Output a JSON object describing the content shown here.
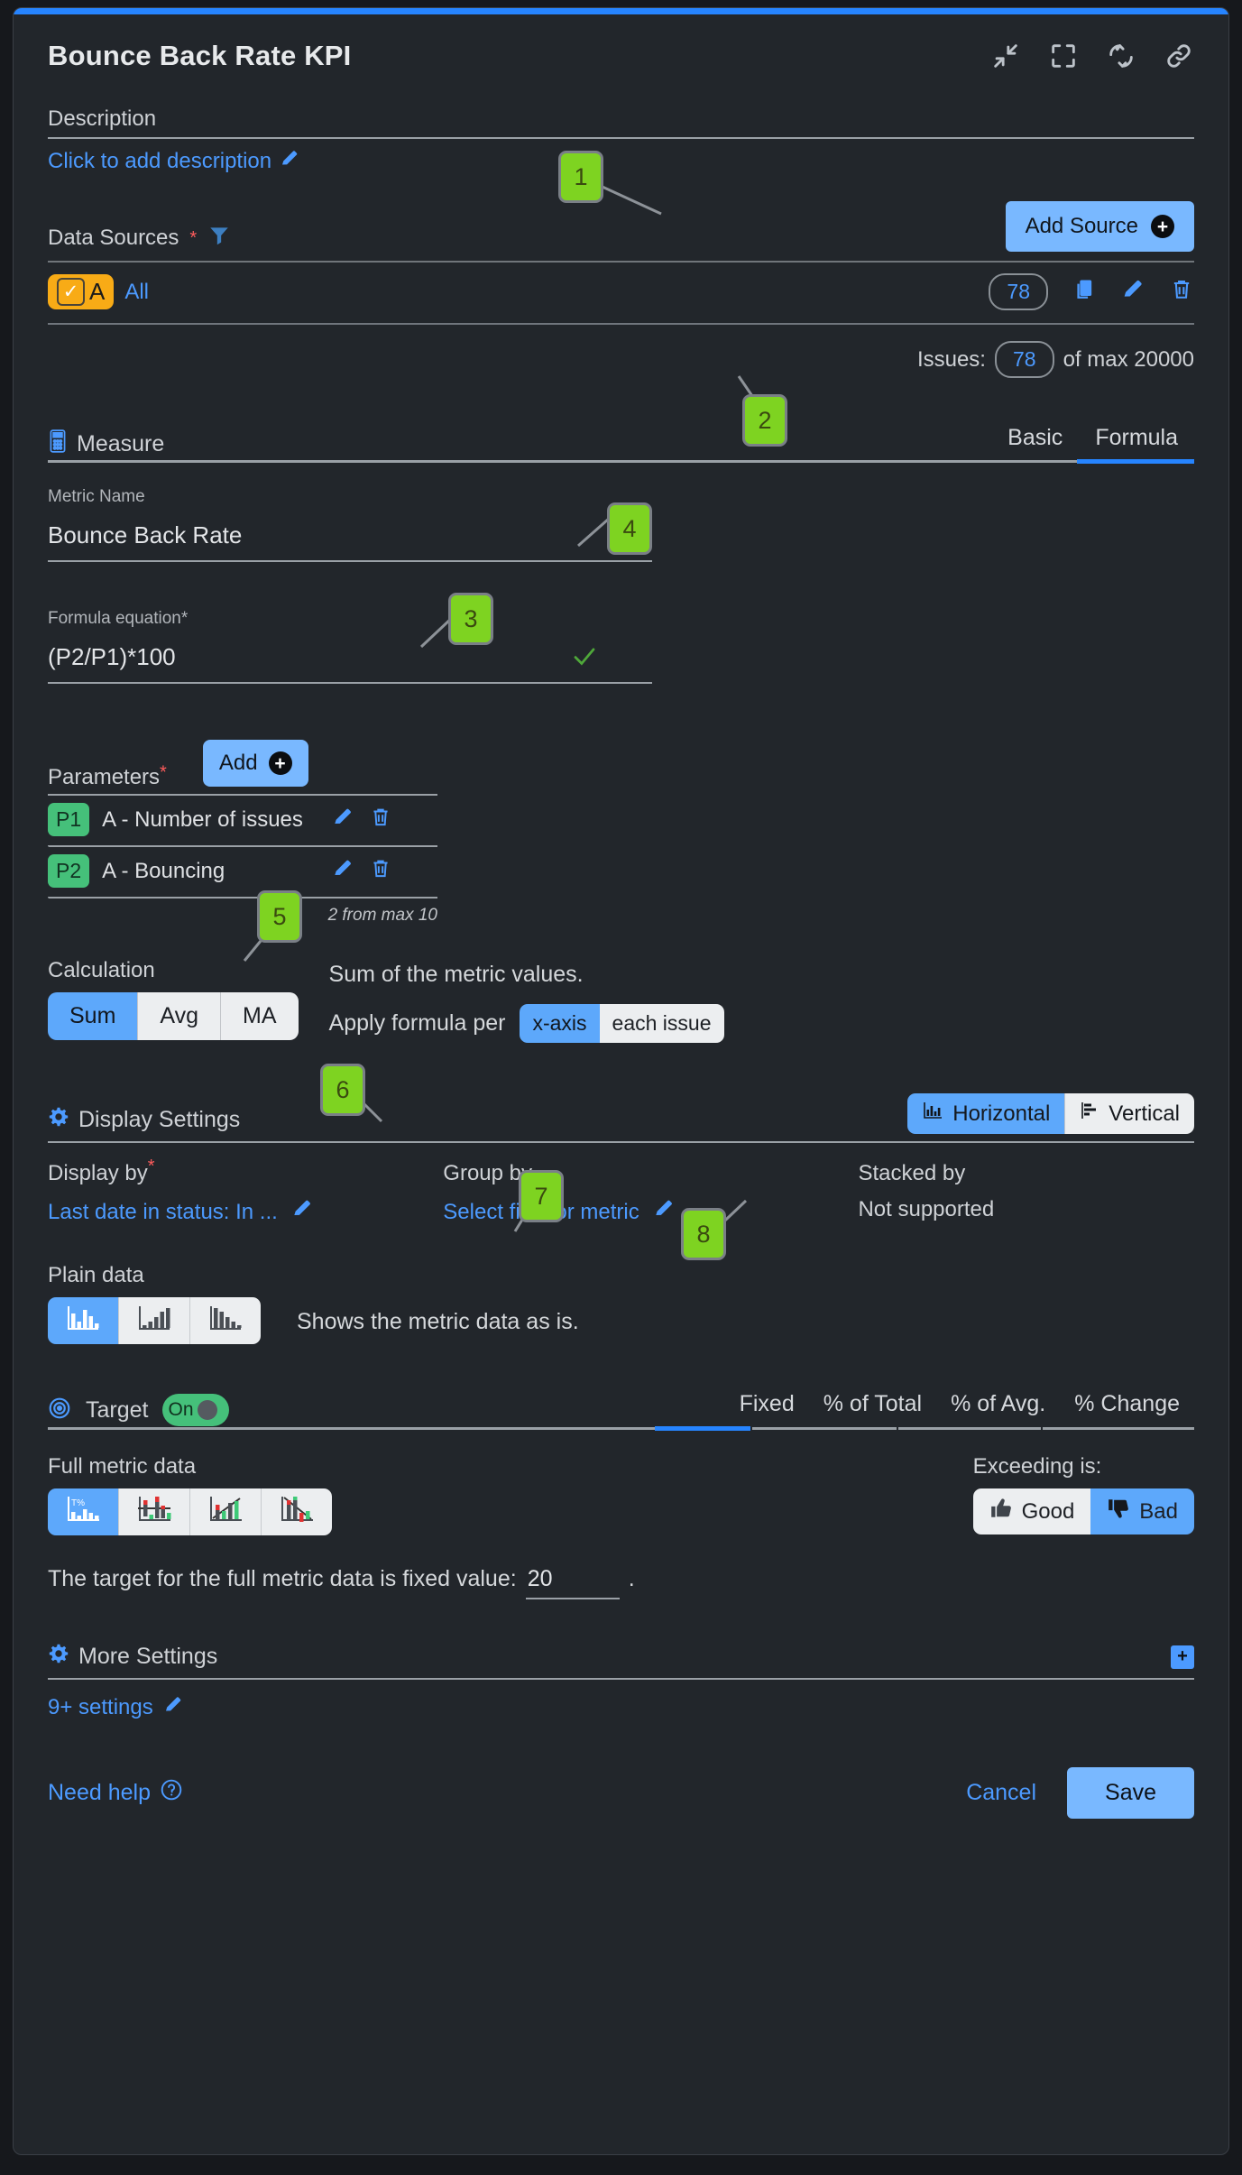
{
  "header": {
    "title": "Bounce Back Rate KPI",
    "icons": [
      "collapse-icon",
      "fullscreen-icon",
      "refresh-icon",
      "link-icon"
    ]
  },
  "description": {
    "label": "Description",
    "placeholder": "Click to add description",
    "edit_icon": "pencil-icon"
  },
  "data_sources": {
    "label": "Data Sources",
    "required": "*",
    "filter_icon": "filter-icon",
    "add_button": "Add Source",
    "rows": [
      {
        "letter": "A",
        "name": "All",
        "count": "78",
        "checked": true,
        "actions": [
          "copy-icon",
          "pencil-icon",
          "trash-icon"
        ]
      }
    ],
    "issues_prefix": "Issues:",
    "issues_count": "78",
    "issues_suffix": "of max 20000"
  },
  "measure": {
    "title": "Measure",
    "icon": "calculator-icon",
    "tabs": [
      {
        "label": "Basic",
        "active": false
      },
      {
        "label": "Formula",
        "active": true
      }
    ],
    "metric_name_label": "Metric Name",
    "metric_name_value": "Bounce Back Rate",
    "formula_label": "Formula equation*",
    "formula_value": "(P2/P1)*100",
    "formula_valid_icon": "check-icon"
  },
  "parameters": {
    "label": "Parameters",
    "required": "*",
    "add_button": "Add",
    "items": [
      {
        "badge": "P1",
        "name": "A - Number of issues",
        "actions": [
          "pencil-icon",
          "trash-icon"
        ]
      },
      {
        "badge": "P2",
        "name": "A - Bouncing",
        "actions": [
          "pencil-icon",
          "trash-icon"
        ]
      }
    ],
    "note": "2 from max 10"
  },
  "calculation": {
    "label": "Calculation",
    "options": [
      {
        "label": "Sum",
        "active": true
      },
      {
        "label": "Avg",
        "active": false
      },
      {
        "label": "MA",
        "active": false
      }
    ],
    "description": "Sum of the metric values.",
    "apply_label": "Apply formula per",
    "apply_options": [
      {
        "label": "x-axis",
        "active": true
      },
      {
        "label": "each issue",
        "active": false
      }
    ]
  },
  "display_settings": {
    "title": "Display Settings",
    "icon": "gear-icon",
    "orientation": [
      {
        "label": "Horizontal",
        "active": true,
        "icon": "bar-chart-horizontal-icon"
      },
      {
        "label": "Vertical",
        "active": false,
        "icon": "bar-chart-vertical-icon"
      }
    ],
    "columns": [
      {
        "label": "Display by",
        "required": "*",
        "value": "Last date in status: In ...",
        "link": true,
        "edit_icon": "pencil-icon"
      },
      {
        "label": "Group by",
        "required": "",
        "value": "Select field or metric",
        "link": true,
        "edit_icon": "pencil-icon"
      },
      {
        "label": "Stacked by",
        "required": "",
        "value": "Not supported",
        "link": false,
        "edit_icon": ""
      }
    ]
  },
  "plain_data": {
    "label": "Plain data",
    "options": [
      {
        "icon": "plain-bars-icon",
        "active": true
      },
      {
        "icon": "cumulative-bars-icon",
        "active": false
      },
      {
        "icon": "descending-bars-icon",
        "active": false
      }
    ],
    "description": "Shows the metric data as is."
  },
  "target": {
    "title": "Target",
    "icon": "target-icon",
    "toggle_label": "On",
    "toggle_on": true,
    "tabs": [
      {
        "label": "Fixed",
        "active": true
      },
      {
        "label": "% of Total",
        "active": false
      },
      {
        "label": "% of Avg.",
        "active": false
      },
      {
        "label": "% Change",
        "active": false
      }
    ],
    "full_metric_label": "Full metric data",
    "full_metric_options": [
      {
        "icon": "target-percent-bars-icon",
        "active": true
      },
      {
        "icon": "deviation-bars-icon",
        "active": false
      },
      {
        "icon": "rising-trend-icon",
        "active": false
      },
      {
        "icon": "falling-trend-icon",
        "active": false
      }
    ],
    "exceeding_label": "Exceeding is:",
    "exceeding_options": [
      {
        "label": "Good",
        "icon": "thumbs-up-icon",
        "active": false
      },
      {
        "label": "Bad",
        "icon": "thumbs-down-icon",
        "active": true
      }
    ],
    "sentence_prefix": "The target for the full metric data is fixed value:",
    "sentence_value": "20",
    "sentence_suffix": "."
  },
  "more_settings": {
    "title": "More Settings",
    "icon": "gear-icon",
    "expand": "+",
    "value": "9+ settings",
    "edit_icon": "pencil-icon"
  },
  "footer": {
    "need_help": "Need help",
    "help_icon": "question-circle-icon",
    "cancel": "Cancel",
    "save": "Save"
  },
  "markers": [
    {
      "id": "1",
      "target": "add-source-button"
    },
    {
      "id": "2",
      "target": "formula-tab"
    },
    {
      "id": "3",
      "target": "parameters-add-button"
    },
    {
      "id": "4",
      "target": "formula-valid-check"
    },
    {
      "id": "5",
      "target": "display-by-value"
    },
    {
      "id": "6",
      "target": "target-tab-fixed"
    },
    {
      "id": "7",
      "target": "target-fixed-value-input"
    },
    {
      "id": "8",
      "target": "exceeding-bad-button"
    }
  ],
  "colors": {
    "accent": "#2684ff",
    "link": "#4c9aff",
    "button": "#79b8ff",
    "marker": "#7ed321",
    "badge_green": "#45c07a",
    "chip_orange": "#f8ab16",
    "background": "#22262b"
  }
}
